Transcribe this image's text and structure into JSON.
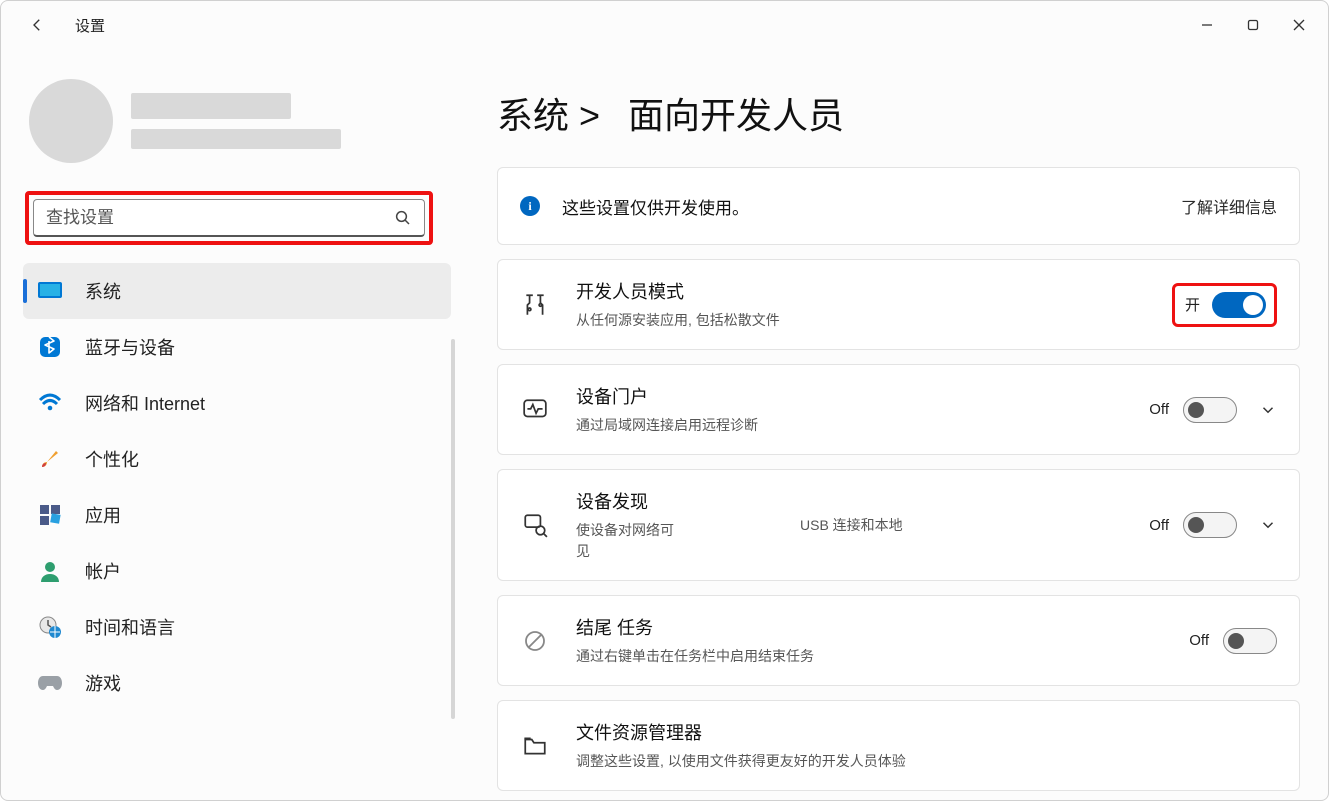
{
  "app_title": "设置",
  "search": {
    "placeholder": "查找设置"
  },
  "sidebar": {
    "items": [
      {
        "label": "系统"
      },
      {
        "label": "蓝牙与设备"
      },
      {
        "label": "网络和 Internet"
      },
      {
        "label": "个性化"
      },
      {
        "label": "应用"
      },
      {
        "label": "帐户"
      },
      {
        "label": "时间和语言"
      },
      {
        "label": "游戏"
      }
    ]
  },
  "breadcrumb": {
    "part1": "系统 >",
    "part2": "面向开发人员"
  },
  "info_banner": {
    "text": "这些设置仅供开发使用。",
    "link": "了解详细信息"
  },
  "rows": {
    "dev_mode": {
      "title": "开发人员模式",
      "sub": "从任何源安装应用, 包括松散文件",
      "state_label": "开"
    },
    "device_portal": {
      "title": "设备门户",
      "sub": "通过局域网连接启用远程诊断",
      "state_label": "Off"
    },
    "device_discovery": {
      "title": "设备发现",
      "sub": "使设备对网络可见",
      "mid": "USB 连接和本地",
      "state_label": "Off"
    },
    "end_task": {
      "title": "结尾 任务",
      "sub": "通过右键单击在任务栏中启用结束任务",
      "state_label": "Off"
    },
    "explorer": {
      "title": "文件资源管理器",
      "sub": "调整这些设置, 以使用文件获得更友好的开发人员体验"
    }
  }
}
